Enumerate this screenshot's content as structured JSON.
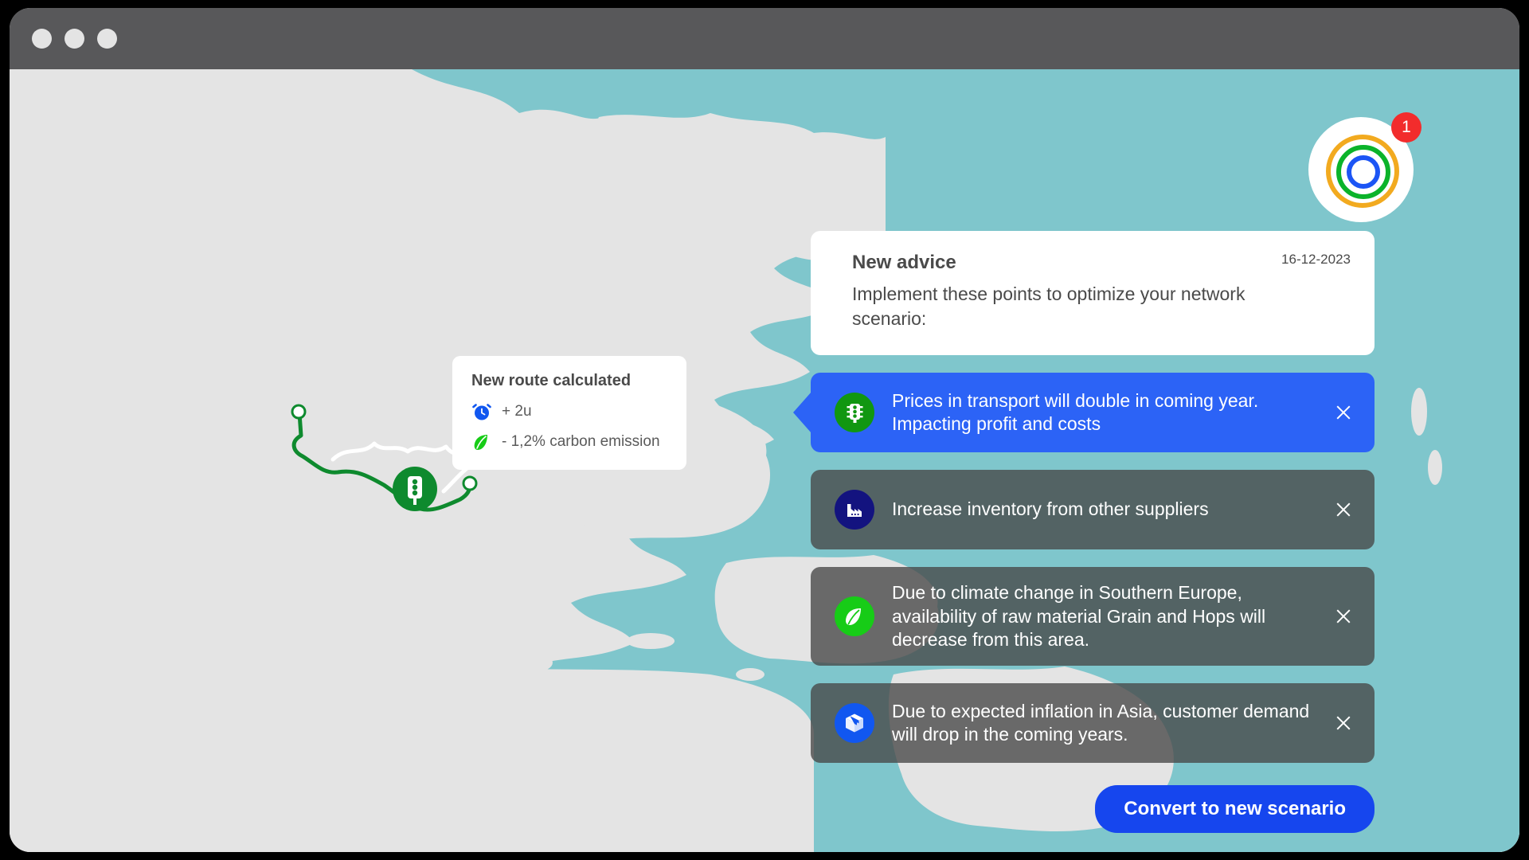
{
  "window": {
    "dots": [
      "close-dot",
      "minimize-dot",
      "maximize-dot"
    ]
  },
  "colors": {
    "sea": "#7FC6CC",
    "land": "#E4E4E4",
    "titlebar": "#58585A",
    "accent_blue": "#2C63F6",
    "button_blue": "#1646EE",
    "muted_card": "rgba(70,70,70,0.78)",
    "green": "#0BB32A",
    "navy": "#1A1A8C",
    "badge_red": "#F22C2C",
    "ring_outer": "#F2AA1F",
    "ring_mid": "#0BB32A",
    "ring_inner": "#1C55F5",
    "route_green": "#0E8A2E"
  },
  "logo": {
    "icon": "concentric-rings-logo",
    "notification_count": "1"
  },
  "route_tooltip": {
    "title": "New route calculated",
    "stats": [
      {
        "icon": "alarm-clock-icon",
        "value": "+ 2u"
      },
      {
        "icon": "leaf-icon",
        "value": "-  1,2% carbon emission"
      }
    ]
  },
  "advice": {
    "title": "New advice",
    "date": "16-12-2023",
    "subtitle": "Implement these points to optimize your network scenario:",
    "items": [
      {
        "icon": "traffic-light-icon",
        "icon_bg": "#119711",
        "theme": "primary",
        "text": "Prices in transport will double in coming year. Impacting profit and costs",
        "close_label": "×"
      },
      {
        "icon": "factory-icon",
        "icon_bg": "#13137F",
        "theme": "muted",
        "text": "Increase inventory from other suppliers",
        "close_label": "×"
      },
      {
        "icon": "leaf-icon",
        "icon_bg": "#17CC17",
        "theme": "muted",
        "text": "Due to climate change in Southern Europe, availability of raw material Grain and Hops will decrease from this area.",
        "close_label": "×"
      },
      {
        "icon": "package-box-icon",
        "icon_bg": "#1157F0",
        "theme": "muted",
        "text": "Due to expected inflation in Asia, customer demand will drop in the coming years.",
        "close_label": "×"
      }
    ],
    "convert_button_label": "Convert to new scenario"
  },
  "map": {
    "region": "europe-mediterranean",
    "route": {
      "marker_icon": "traffic-light-marker",
      "origin_node": "route-origin-node",
      "destination_node": "route-destination-node",
      "alternate_path": "white-alternate-route"
    }
  }
}
